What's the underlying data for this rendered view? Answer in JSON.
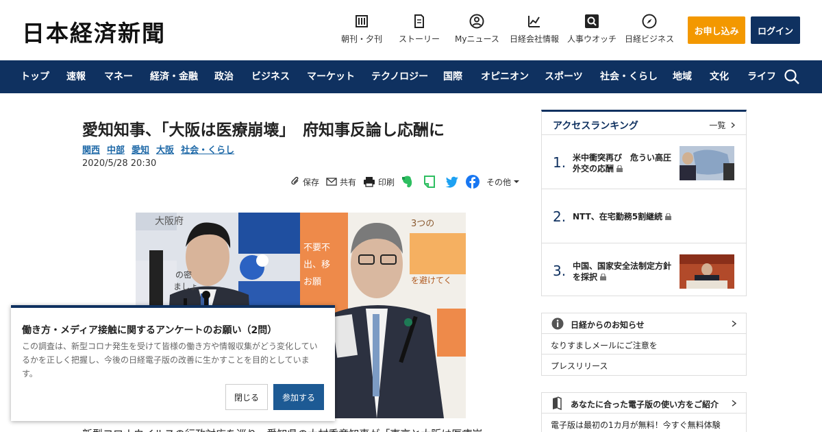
{
  "site": {
    "logo": "日本経済新聞",
    "nav_icons": [
      {
        "label": "朝刊・夕刊",
        "icon": "newspaper-icon"
      },
      {
        "label": "ストーリー",
        "icon": "story-icon"
      },
      {
        "label": "Myニュース",
        "icon": "user-icon"
      },
      {
        "label": "日経会社情報",
        "icon": "chart-icon"
      },
      {
        "label": "人事ウオッチ",
        "icon": "magnifier-icon"
      },
      {
        "label": "日経ビジネス",
        "icon": "compass-icon"
      }
    ],
    "subscribe_label": "お申し込み",
    "login_label": "ログイン"
  },
  "main_nav": [
    "トップ",
    "速報",
    "マネー",
    "経済・金融",
    "政治",
    "ビジネス",
    "マーケット",
    "テクノロジー",
    "国際",
    "オピニオン",
    "スポーツ",
    "社会・くらし",
    "地域",
    "文化",
    "ライフ"
  ],
  "article": {
    "title": "愛知知事、「大阪は医療崩壊」　府知事反論し応酬に",
    "tags": [
      "関西",
      "中部",
      "愛知",
      "大阪",
      "社会・くらし"
    ],
    "date": "2020/5/28 20:30",
    "tools": {
      "save": "保存",
      "share": "共有",
      "print": "印刷",
      "more": "その他"
    },
    "photo_sign_text": "大阪府",
    "photo_panel_text": "3つの",
    "photo_text_1": "の密",
    "photo_text_2": "ましょ",
    "photo_text_3": "を避けてく",
    "photo_text_4": "不要不",
    "photo_text_5": "出、移",
    "photo_text_6": "お願",
    "body_first_line": "新型コロナウイルスの行政対応を巡り、愛知県の大村秀章知事が「東京と大阪は医療崩"
  },
  "survey": {
    "title": "働き方・メディア接触に関するアンケートのお願い（2問）",
    "text": "この調査は、新型コロナ発生を受けて皆様の働き方や情報収集がどう変化しているかを正しく把握し、今後の日経電子版の改善に生かすことを目的としています。",
    "close_label": "閉じる",
    "join_label": "参加する"
  },
  "ranking": {
    "title": "アクセスランキング",
    "more_label": "一覧",
    "items": [
      {
        "rank": "1.",
        "text": "米中衝突再び　危うい高圧外交の応酬"
      },
      {
        "rank": "2.",
        "text": "NTT、在宅勤務5割継続"
      },
      {
        "rank": "3.",
        "text": "中国、国家安全法制定方針を採択"
      }
    ]
  },
  "notices": {
    "title": "日経からのお知らせ",
    "items": [
      "なりすましメールにご注意を",
      "プレスリリース"
    ]
  },
  "guide": {
    "title": "あなたに合った電子版の使い方をご紹介",
    "items": [
      "電子版は最初の1カ月が無料！今すぐ無料体験"
    ]
  },
  "colors": {
    "brand_navy": "#0f3160",
    "accent_orange": "#f39800",
    "link_blue": "#1d68a7"
  }
}
